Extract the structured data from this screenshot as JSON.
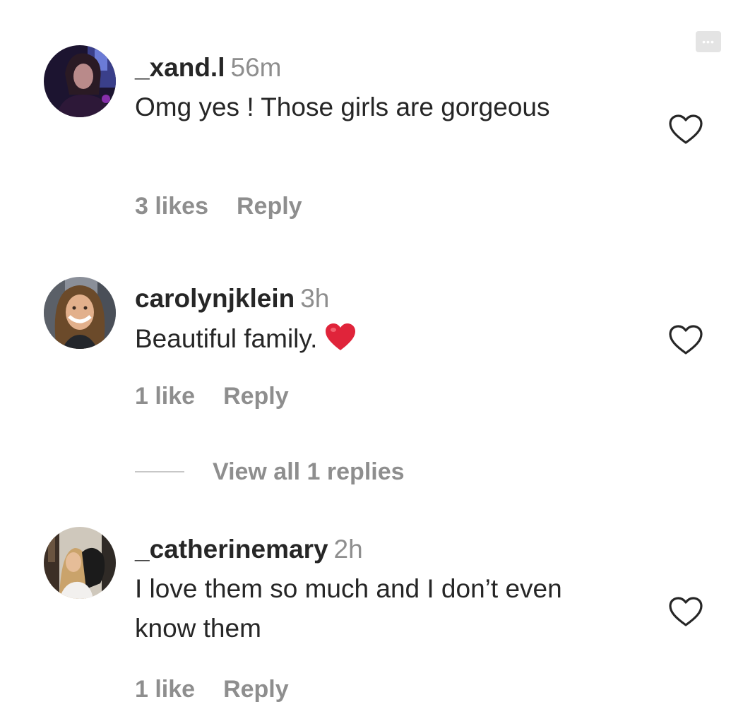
{
  "comments": [
    {
      "username": "_xand.l",
      "time": "56m",
      "text": "Omg yes ! Those girls are gorgeous",
      "likes": "3 likes",
      "reply": "Reply",
      "avatar": "avatar-dark-photo-icon"
    },
    {
      "username": "carolynjklein",
      "time": "3h",
      "text": "Beautiful family.",
      "emoji": "red-heart-emoji",
      "likes": "1 like",
      "reply": "Reply",
      "view_replies": "View all 1 replies",
      "avatar": "avatar-smiling-woman-icon"
    },
    {
      "username": "_catherinemary",
      "time": "2h",
      "text": "I love them so much and I don’t even know them",
      "likes": "1 like",
      "reply": "Reply",
      "avatar": "avatar-woman-with-dog-icon"
    }
  ],
  "icons": {
    "like": "heart-outline-icon",
    "more": "more-options-icon"
  },
  "colors": {
    "primary_text": "#262626",
    "secondary_text": "#8e8e8e",
    "heart_emoji": "#e0243a"
  }
}
